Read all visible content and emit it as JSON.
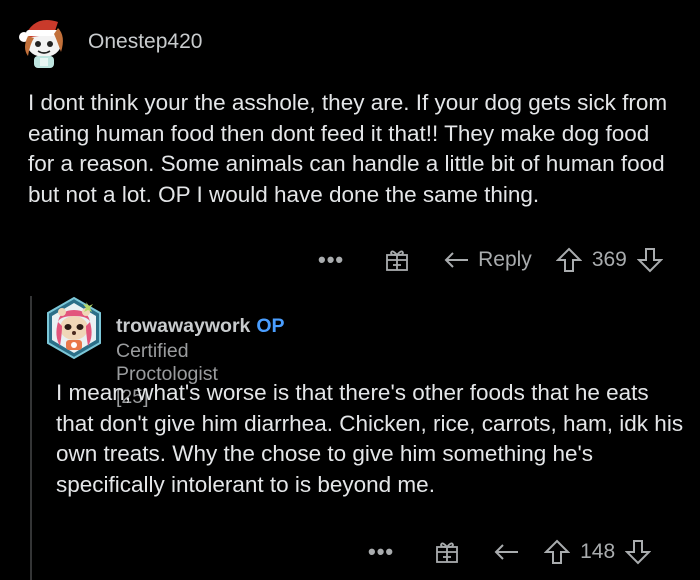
{
  "comment": {
    "username": "Onestep420",
    "body": "I dont think your the asshole, they are.  If your dog gets sick from eating human food then dont feed it that!! They make dog food for a reason.  Some animals can handle a little bit of human food but not a lot.  OP I would have done the same thing.",
    "more_label": "•••",
    "reply_label": "Reply",
    "score": "369"
  },
  "reply": {
    "username": "trowawaywork",
    "op_badge": "OP",
    "flair": "Certified Proctologist [25]",
    "body": "I mean, what's worse is that there's other foods that he eats that don't give him diarrhea. Chicken, rice, carrots, ham, idk his own treats. Why the chose to give him something he's specifically intolerant to is beyond me.",
    "more_label": "•••",
    "score": "148"
  },
  "colors": {
    "background": "#000000",
    "text": "#e4e6e8",
    "muted": "#a9acae",
    "op_accent": "#4a9eff"
  }
}
